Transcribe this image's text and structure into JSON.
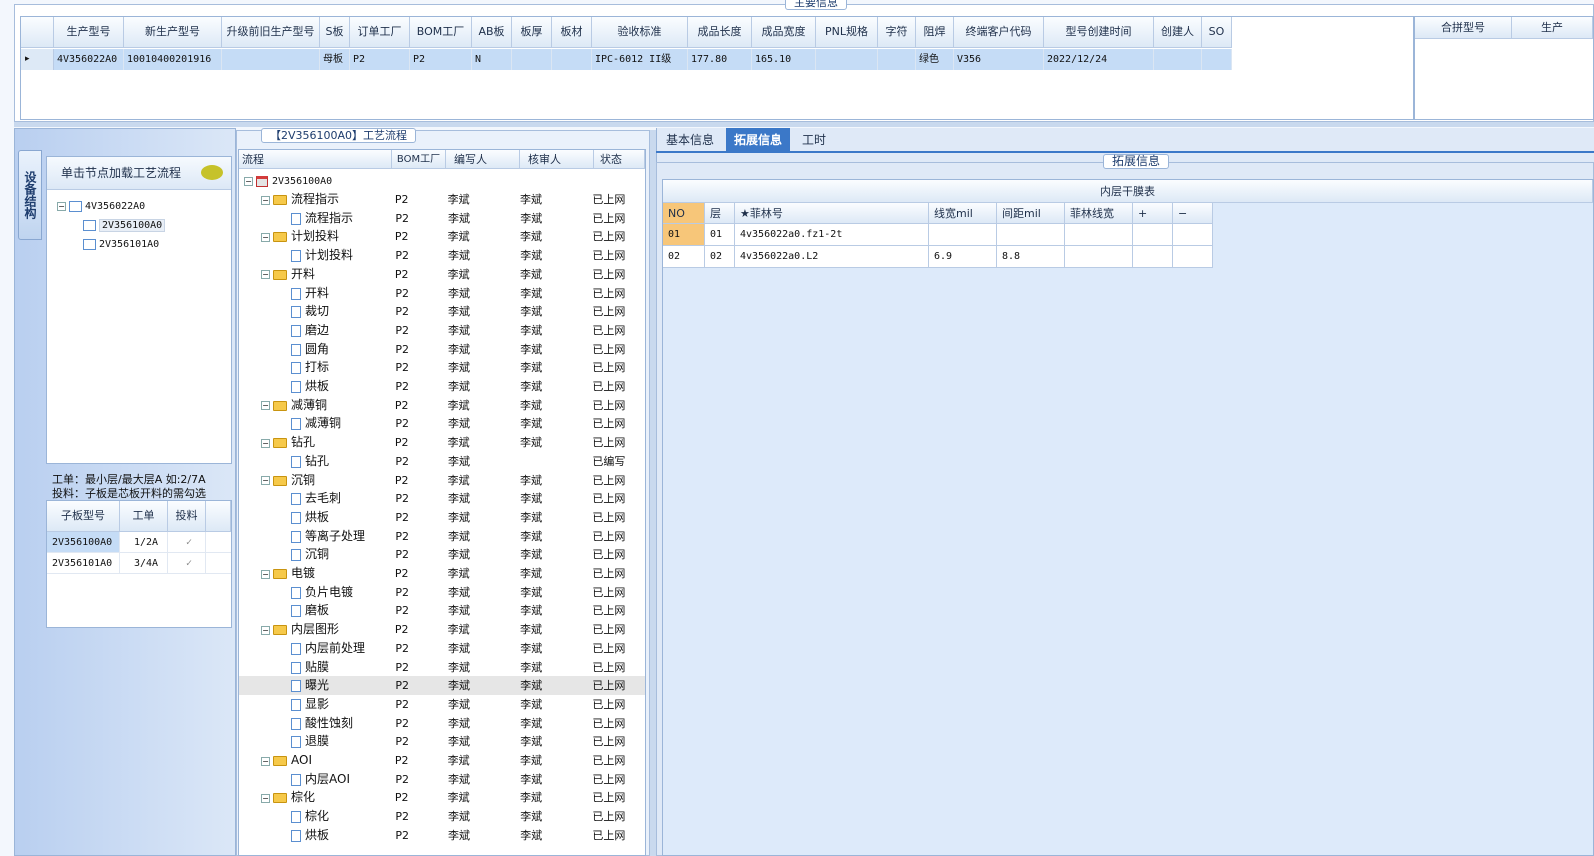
{
  "top_panel": {
    "title": "主要信息",
    "columns": [
      "生产型号",
      "新生产型号",
      "升级前旧生产型号",
      "S板",
      "订单工厂",
      "BOM工厂",
      "AB板",
      "板厚",
      "板材",
      "验收标准",
      "成品长度",
      "成品宽度",
      "PNL规格",
      "字符",
      "阻焊",
      "终端客户代码",
      "型号创建时间",
      "创建人",
      "SO"
    ],
    "row": [
      "4V356022A0",
      "10010400201916",
      "",
      "母板",
      "P2",
      "P2",
      "N",
      "",
      "",
      "IPC-6012 II级",
      "177.80",
      "165.10",
      "",
      "",
      "绿色",
      "V356",
      "2022/12/24",
      "",
      ""
    ],
    "side_columns": [
      "合拼型号",
      "生产"
    ]
  },
  "left_panel": {
    "vertical_tab": "设备结构",
    "load_hint": "单击节点加载工艺流程",
    "tree": [
      {
        "label": "4V356022A0",
        "level": 0,
        "toggle": "⊟"
      },
      {
        "label": "2V356100A0",
        "level": 1,
        "toggle": ""
      },
      {
        "label": "2V356101A0",
        "level": 1,
        "toggle": ""
      }
    ],
    "note_line1": "工单：最小层/最大层A 如:2/7A",
    "note_line2": "投料：子板是芯板开料的需勾选",
    "sub_columns": [
      "子板型号",
      "工单",
      "投料"
    ],
    "sub_rows": [
      {
        "model": "2V356100A0",
        "order": "1/2A",
        "feed": "✓"
      },
      {
        "model": "2V356101A0",
        "order": "3/4A",
        "feed": "✓"
      }
    ]
  },
  "process": {
    "title": "【2V356100A0】工艺流程",
    "columns": [
      "流程",
      "BOM工厂",
      "编写人",
      "核审人",
      "状态"
    ],
    "root": "2V356100A0",
    "rows": [
      {
        "name": "流程指示",
        "kind": "folder",
        "f": "P2",
        "w": "李斌",
        "r": "李斌",
        "s": "已上网"
      },
      {
        "name": "流程指示",
        "kind": "doc",
        "f": "P2",
        "w": "李斌",
        "r": "李斌",
        "s": "已上网"
      },
      {
        "name": "计划投料",
        "kind": "folder",
        "f": "P2",
        "w": "李斌",
        "r": "李斌",
        "s": "已上网"
      },
      {
        "name": "计划投料",
        "kind": "doc",
        "f": "P2",
        "w": "李斌",
        "r": "李斌",
        "s": "已上网"
      },
      {
        "name": "开料",
        "kind": "folder",
        "f": "P2",
        "w": "李斌",
        "r": "李斌",
        "s": "已上网"
      },
      {
        "name": "开料",
        "kind": "doc",
        "f": "P2",
        "w": "李斌",
        "r": "李斌",
        "s": "已上网"
      },
      {
        "name": "裁切",
        "kind": "doc",
        "f": "P2",
        "w": "李斌",
        "r": "李斌",
        "s": "已上网"
      },
      {
        "name": "磨边",
        "kind": "doc",
        "f": "P2",
        "w": "李斌",
        "r": "李斌",
        "s": "已上网"
      },
      {
        "name": "圆角",
        "kind": "doc",
        "f": "P2",
        "w": "李斌",
        "r": "李斌",
        "s": "已上网"
      },
      {
        "name": "打标",
        "kind": "doc",
        "f": "P2",
        "w": "李斌",
        "r": "李斌",
        "s": "已上网"
      },
      {
        "name": "烘板",
        "kind": "doc",
        "f": "P2",
        "w": "李斌",
        "r": "李斌",
        "s": "已上网"
      },
      {
        "name": "减薄铜",
        "kind": "folder",
        "f": "P2",
        "w": "李斌",
        "r": "李斌",
        "s": "已上网"
      },
      {
        "name": "减薄铜",
        "kind": "doc",
        "f": "P2",
        "w": "李斌",
        "r": "李斌",
        "s": "已上网"
      },
      {
        "name": "钻孔",
        "kind": "folder",
        "f": "P2",
        "w": "李斌",
        "r": "李斌",
        "s": "已上网"
      },
      {
        "name": "钻孔",
        "kind": "doc",
        "f": "P2",
        "w": "李斌",
        "r": "",
        "s": "已编写"
      },
      {
        "name": "沉铜",
        "kind": "folder",
        "f": "P2",
        "w": "李斌",
        "r": "李斌",
        "s": "已上网"
      },
      {
        "name": "去毛刺",
        "kind": "doc",
        "f": "P2",
        "w": "李斌",
        "r": "李斌",
        "s": "已上网"
      },
      {
        "name": "烘板",
        "kind": "doc",
        "f": "P2",
        "w": "李斌",
        "r": "李斌",
        "s": "已上网"
      },
      {
        "name": "等离子处理",
        "kind": "doc",
        "f": "P2",
        "w": "李斌",
        "r": "李斌",
        "s": "已上网"
      },
      {
        "name": "沉铜",
        "kind": "doc",
        "f": "P2",
        "w": "李斌",
        "r": "李斌",
        "s": "已上网"
      },
      {
        "name": "电镀",
        "kind": "folder",
        "f": "P2",
        "w": "李斌",
        "r": "李斌",
        "s": "已上网"
      },
      {
        "name": "负片电镀",
        "kind": "doc",
        "f": "P2",
        "w": "李斌",
        "r": "李斌",
        "s": "已上网"
      },
      {
        "name": "磨板",
        "kind": "doc",
        "f": "P2",
        "w": "李斌",
        "r": "李斌",
        "s": "已上网"
      },
      {
        "name": "内层图形",
        "kind": "folder",
        "f": "P2",
        "w": "李斌",
        "r": "李斌",
        "s": "已上网"
      },
      {
        "name": "内层前处理",
        "kind": "doc",
        "f": "P2",
        "w": "李斌",
        "r": "李斌",
        "s": "已上网"
      },
      {
        "name": "贴膜",
        "kind": "doc",
        "f": "P2",
        "w": "李斌",
        "r": "李斌",
        "s": "已上网"
      },
      {
        "name": "曝光",
        "kind": "doc",
        "f": "P2",
        "w": "李斌",
        "r": "李斌",
        "s": "已上网",
        "selected": true
      },
      {
        "name": "显影",
        "kind": "doc",
        "f": "P2",
        "w": "李斌",
        "r": "李斌",
        "s": "已上网"
      },
      {
        "name": "酸性蚀刻",
        "kind": "doc",
        "f": "P2",
        "w": "李斌",
        "r": "李斌",
        "s": "已上网"
      },
      {
        "name": "退膜",
        "kind": "doc",
        "f": "P2",
        "w": "李斌",
        "r": "李斌",
        "s": "已上网"
      },
      {
        "name": "AOI",
        "kind": "folder",
        "f": "P2",
        "w": "李斌",
        "r": "李斌",
        "s": "已上网"
      },
      {
        "name": "内层AOI",
        "kind": "doc",
        "f": "P2",
        "w": "李斌",
        "r": "李斌",
        "s": "已上网"
      },
      {
        "name": "棕化",
        "kind": "folder",
        "f": "P2",
        "w": "李斌",
        "r": "李斌",
        "s": "已上网"
      },
      {
        "name": "棕化",
        "kind": "doc",
        "f": "P2",
        "w": "李斌",
        "r": "李斌",
        "s": "已上网"
      },
      {
        "name": "烘板",
        "kind": "doc",
        "f": "P2",
        "w": "李斌",
        "r": "李斌",
        "s": "已上网"
      }
    ]
  },
  "right_panel": {
    "tabs": [
      "基本信息",
      "拓展信息",
      "工时"
    ],
    "active_tab": 1,
    "group_title": "拓展信息",
    "table_title": "内层干膜表",
    "columns": [
      "NO",
      "层",
      "★菲林号",
      "线宽mil",
      "间距mil",
      "菲林线宽",
      "+",
      "−"
    ],
    "rows": [
      [
        "01",
        "01",
        "4v356022a0.fz1-2t",
        "",
        "",
        "",
        "",
        ""
      ],
      [
        "02",
        "02",
        "4v356022a0.L2",
        "6.9",
        "8.8",
        "",
        "",
        ""
      ]
    ]
  },
  "colors": {
    "selected_row": "#c5dcf6",
    "accent": "#3b78c8",
    "header_bg": "#dde9f6"
  }
}
